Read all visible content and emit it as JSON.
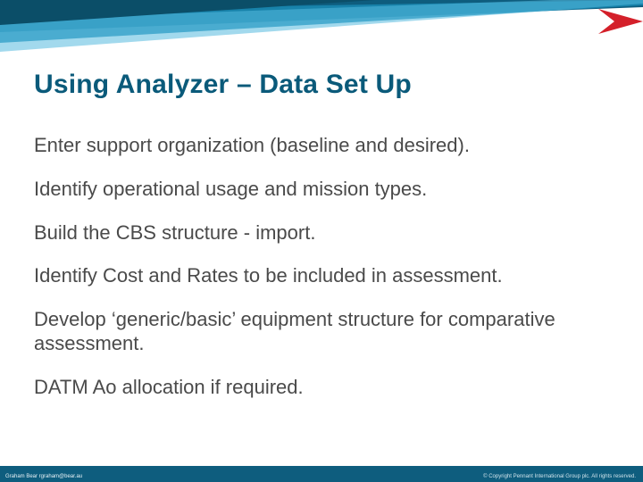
{
  "title": "Using Analyzer – Data Set Up",
  "bullets": [
    "Enter support organization (baseline and desired).",
    "Identify operational usage and mission types.",
    "Build the CBS structure - import.",
    "Identify Cost and Rates to be included in assessment.",
    "Develop ‘generic/basic’ equipment structure for comparative assessment.",
    "DATM Ao allocation if required."
  ],
  "footer_left": "Graham Bear   rgraham@bear.au",
  "footer_right": "© Copyright Pennant International Group plc. All rights reserved."
}
